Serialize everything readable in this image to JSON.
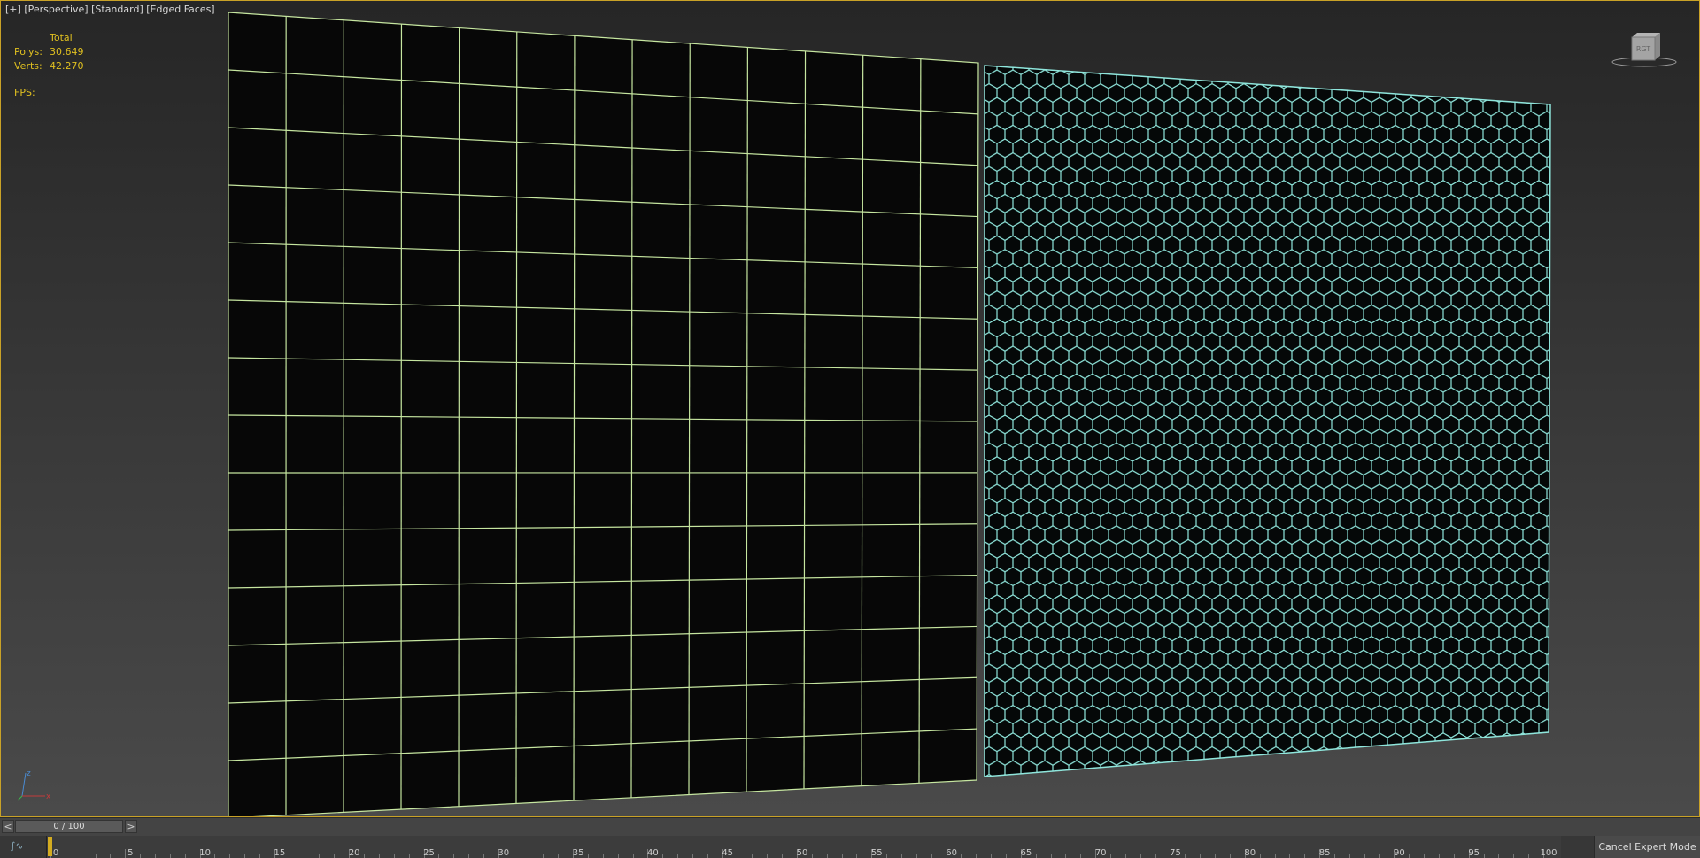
{
  "viewport": {
    "labels": [
      "[+]",
      "[Perspective]",
      "[Standard]",
      "[Edged Faces]"
    ]
  },
  "stats": {
    "header": "Total",
    "polys_label": "Polys:",
    "polys_value": "30.649",
    "verts_label": "Verts:",
    "verts_value": "42.270",
    "fps_label": "FPS:"
  },
  "viewcube": {
    "face_label": "RGT"
  },
  "axis": {
    "z": "z",
    "x": "x"
  },
  "timeline": {
    "prev_label": "<",
    "slider_value": "0 / 100",
    "next_label": ">",
    "curve_icon": "∫∿",
    "ticks": [
      0,
      5,
      10,
      15,
      20,
      25,
      30,
      35,
      40,
      45,
      50,
      55,
      60,
      65,
      70,
      75,
      80,
      85,
      90,
      95,
      100
    ]
  },
  "expert_button": {
    "label": "Cancel Expert Mode"
  },
  "colors": {
    "viewport_border": "#c9a227",
    "stats_text": "#e0c020",
    "quad_wire": "#c6e6a0",
    "hex_wire": "#8fe6dc",
    "time_marker": "#d4ac20"
  }
}
